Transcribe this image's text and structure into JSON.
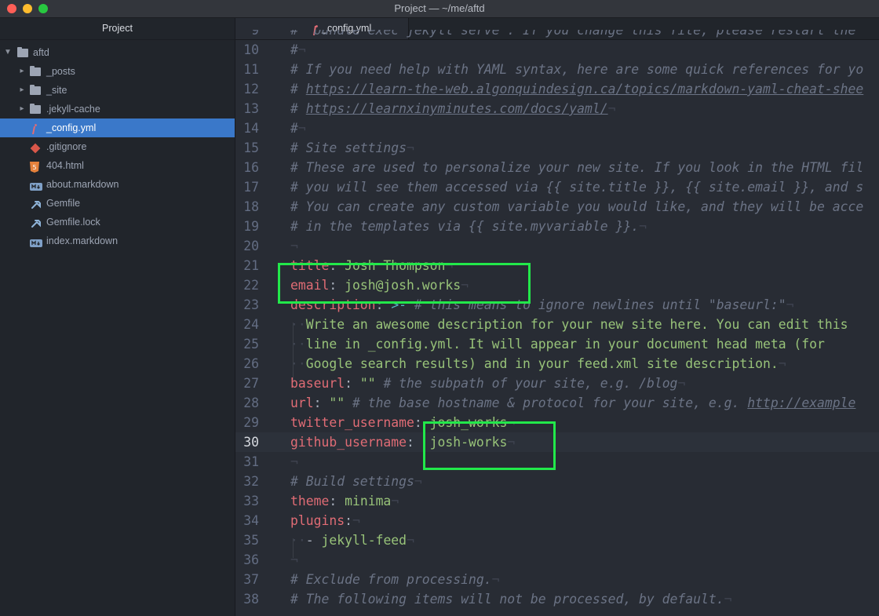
{
  "window": {
    "title": "Project — ~/me/aftd",
    "traffic_lights": [
      "#fe5f57",
      "#febc2e",
      "#28c840"
    ]
  },
  "sidebar": {
    "title": "Project",
    "root": "aftd",
    "items": [
      {
        "label": "_posts",
        "icon": "folder-icon",
        "kind": "folder"
      },
      {
        "label": "_site",
        "icon": "folder-icon",
        "kind": "folder"
      },
      {
        "label": ".jekyll-cache",
        "icon": "folder-icon",
        "kind": "folder"
      },
      {
        "label": "_config.yml",
        "icon": "yaml-file-icon",
        "kind": "file",
        "selected": true
      },
      {
        "label": ".gitignore",
        "icon": "git-file-icon",
        "kind": "file"
      },
      {
        "label": "404.html",
        "icon": "html5-file-icon",
        "kind": "file"
      },
      {
        "label": "about.markdown",
        "icon": "markdown-file-icon",
        "kind": "file"
      },
      {
        "label": "Gemfile",
        "icon": "ruby-gemfile-icon",
        "kind": "file"
      },
      {
        "label": "Gemfile.lock",
        "icon": "ruby-gemfile-icon",
        "kind": "file"
      },
      {
        "label": "index.markdown",
        "icon": "markdown-file-icon",
        "kind": "file"
      }
    ]
  },
  "tab": {
    "label": "_config.yml",
    "icon": "yaml-file-icon"
  },
  "editor": {
    "current_line": "30",
    "lines": [
      {
        "n": "9",
        "segs": [
          {
            "t": "#  bundle exec jekyll serve . If you change this file, please restart the",
            "c": "c"
          }
        ]
      },
      {
        "n": "10",
        "segs": [
          {
            "t": "#",
            "c": "c"
          },
          {
            "t": "¬",
            "c": "inv"
          }
        ]
      },
      {
        "n": "11",
        "segs": [
          {
            "t": "# If you need help with YAML syntax, here are some quick references for yo",
            "c": "c"
          }
        ]
      },
      {
        "n": "12",
        "segs": [
          {
            "t": "# ",
            "c": "c"
          },
          {
            "t": "https://learn-the-web.algonquindesign.ca/topics/markdown-yaml-cheat-shee",
            "c": "u"
          }
        ]
      },
      {
        "n": "13",
        "segs": [
          {
            "t": "# ",
            "c": "c"
          },
          {
            "t": "https://learnxinyminutes.com/docs/yaml/",
            "c": "u"
          },
          {
            "t": "¬",
            "c": "inv"
          }
        ]
      },
      {
        "n": "14",
        "segs": [
          {
            "t": "#",
            "c": "c"
          },
          {
            "t": "¬",
            "c": "inv"
          }
        ]
      },
      {
        "n": "15",
        "segs": [
          {
            "t": "# Site settings",
            "c": "c"
          },
          {
            "t": "¬",
            "c": "inv"
          }
        ]
      },
      {
        "n": "16",
        "segs": [
          {
            "t": "# These are used to personalize your new site. If you look in the HTML fil",
            "c": "c"
          }
        ]
      },
      {
        "n": "17",
        "segs": [
          {
            "t": "# you will see them accessed via {{ site.title }}, {{ site.email }}, and s",
            "c": "c"
          }
        ]
      },
      {
        "n": "18",
        "segs": [
          {
            "t": "# You can create any custom variable you would like, and they will be acce",
            "c": "c"
          }
        ]
      },
      {
        "n": "19",
        "segs": [
          {
            "t": "# in the templates via {{ site.myvariable }}.",
            "c": "c"
          },
          {
            "t": "¬",
            "c": "inv"
          }
        ]
      },
      {
        "n": "20",
        "segs": [
          {
            "t": "¬",
            "c": "inv"
          }
        ]
      },
      {
        "n": "21",
        "segs": [
          {
            "t": "title",
            "c": "k"
          },
          {
            "t": ": ",
            "c": "p"
          },
          {
            "t": "Josh Thompson",
            "c": "s"
          },
          {
            "t": "¬",
            "c": "inv"
          }
        ]
      },
      {
        "n": "22",
        "segs": [
          {
            "t": "email",
            "c": "k"
          },
          {
            "t": ": ",
            "c": "p"
          },
          {
            "t": "josh@josh.works",
            "c": "s"
          },
          {
            "t": "¬",
            "c": "inv"
          }
        ]
      },
      {
        "n": "23",
        "segs": [
          {
            "t": "description",
            "c": "k"
          },
          {
            "t": ": ",
            "c": "p"
          },
          {
            "t": ">-",
            "c": "o"
          },
          {
            "t": " # this means to ignore newlines until \"baseurl:\"",
            "c": "c"
          },
          {
            "t": "¬",
            "c": "inv"
          }
        ]
      },
      {
        "n": "24",
        "segs": [
          {
            "t": "··",
            "c": "indent"
          },
          {
            "t": "Write an awesome description for your new site here. You can edit this",
            "c": "s"
          }
        ]
      },
      {
        "n": "25",
        "segs": [
          {
            "t": "··",
            "c": "indent"
          },
          {
            "t": "line in _config.yml. It will appear in your document head meta (for",
            "c": "s"
          }
        ]
      },
      {
        "n": "26",
        "segs": [
          {
            "t": "··",
            "c": "indent"
          },
          {
            "t": "Google search results) and in your feed.xml site description.",
            "c": "s"
          },
          {
            "t": "¬",
            "c": "inv"
          }
        ]
      },
      {
        "n": "27",
        "segs": [
          {
            "t": "baseurl",
            "c": "k"
          },
          {
            "t": ": ",
            "c": "p"
          },
          {
            "t": "\"\"",
            "c": "s"
          },
          {
            "t": " # the subpath of your site, e.g. /blog",
            "c": "c"
          },
          {
            "t": "¬",
            "c": "inv"
          }
        ]
      },
      {
        "n": "28",
        "segs": [
          {
            "t": "url",
            "c": "k"
          },
          {
            "t": ": ",
            "c": "p"
          },
          {
            "t": "\"\"",
            "c": "s"
          },
          {
            "t": " # the base hostname & protocol for your site, e.g. ",
            "c": "c"
          },
          {
            "t": "http://example",
            "c": "u"
          }
        ]
      },
      {
        "n": "29",
        "segs": [
          {
            "t": "twitter_username",
            "c": "k"
          },
          {
            "t": ": ",
            "c": "p"
          },
          {
            "t": "josh_works",
            "c": "s"
          },
          {
            "t": "¬",
            "c": "inv"
          }
        ]
      },
      {
        "n": "30",
        "segs": [
          {
            "t": "github_username",
            "c": "k"
          },
          {
            "t": ":  ",
            "c": "p"
          },
          {
            "t": "josh-works",
            "c": "s"
          },
          {
            "t": "¬",
            "c": "inv"
          }
        ]
      },
      {
        "n": "31",
        "segs": [
          {
            "t": "¬",
            "c": "inv"
          }
        ]
      },
      {
        "n": "32",
        "segs": [
          {
            "t": "# Build settings",
            "c": "c"
          },
          {
            "t": "¬",
            "c": "inv"
          }
        ]
      },
      {
        "n": "33",
        "segs": [
          {
            "t": "theme",
            "c": "k"
          },
          {
            "t": ": ",
            "c": "p"
          },
          {
            "t": "minima",
            "c": "s"
          },
          {
            "t": "¬",
            "c": "inv"
          }
        ]
      },
      {
        "n": "34",
        "segs": [
          {
            "t": "plugins",
            "c": "k"
          },
          {
            "t": ":",
            "c": "p"
          },
          {
            "t": "¬",
            "c": "inv"
          }
        ]
      },
      {
        "n": "35",
        "segs": [
          {
            "t": "··",
            "c": "indent"
          },
          {
            "t": "- ",
            "c": "p"
          },
          {
            "t": "jekyll-feed",
            "c": "s"
          },
          {
            "t": "¬",
            "c": "inv"
          }
        ]
      },
      {
        "n": "36",
        "segs": [
          {
            "t": "¬",
            "c": "inv"
          }
        ]
      },
      {
        "n": "37",
        "segs": [
          {
            "t": "# Exclude from processing.",
            "c": "c"
          },
          {
            "t": "¬",
            "c": "inv"
          }
        ]
      },
      {
        "n": "38",
        "segs": [
          {
            "t": "# The following items will not be processed, by default.",
            "c": "c"
          },
          {
            "t": "¬",
            "c": "inv"
          }
        ]
      }
    ]
  },
  "highlights": [
    "title-email-highlight",
    "usernames-highlight"
  ]
}
